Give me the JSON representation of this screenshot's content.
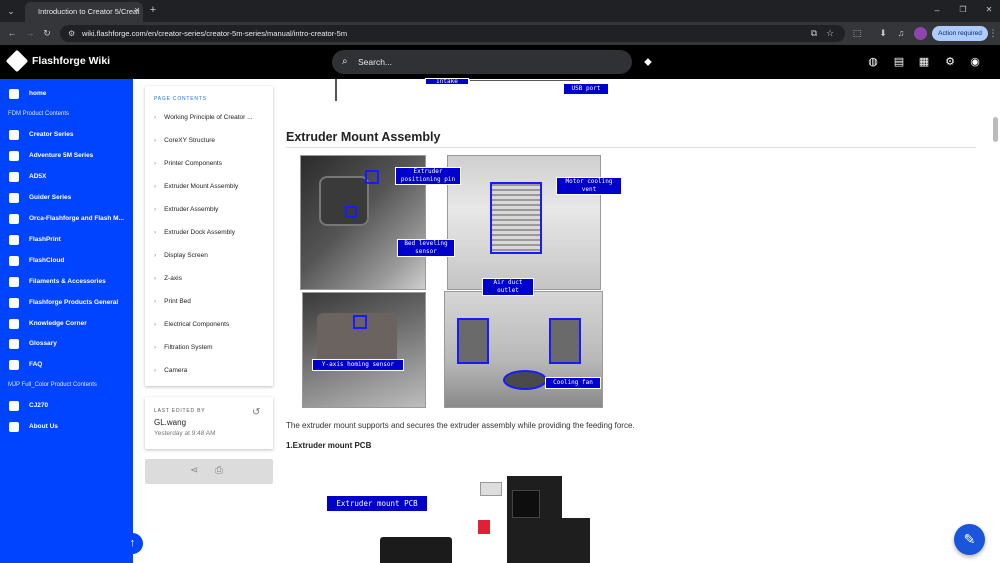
{
  "browser": {
    "tab_title": "Introduction to Creator 5/Creat",
    "url": "wiki.flashforge.com/en/creator-series/creator-5m-series/manual/intro-creator-5m",
    "action_label": "Action required"
  },
  "header": {
    "site_title": "Flashforge Wiki",
    "search_placeholder": "Search..."
  },
  "sidebar": {
    "items": [
      {
        "label": "home",
        "icon": "home-icon"
      },
      {
        "label": "FDM Product Contents",
        "section": true
      },
      {
        "label": "Creator Series",
        "icon": "creator-icon"
      },
      {
        "label": "Adventure 5M Series",
        "icon": "adventure-icon"
      },
      {
        "label": "AD5X",
        "icon": "ad5x-icon"
      },
      {
        "label": "Guider Series",
        "icon": "guider-icon"
      },
      {
        "label": "Orca-Flashforge and Flash M...",
        "icon": "orca-icon"
      },
      {
        "label": "FlashPrint",
        "icon": "flashprint-icon"
      },
      {
        "label": "FlashCloud",
        "icon": "cloud-icon"
      },
      {
        "label": "Filaments & Accessories",
        "icon": "filament-icon"
      },
      {
        "label": "Flashforge Products General",
        "icon": "gear-icon"
      },
      {
        "label": "Knowledge Corner",
        "icon": "knowledge-icon"
      },
      {
        "label": "Glossary",
        "icon": "sort-icon"
      },
      {
        "label": "FAQ",
        "icon": "help-icon"
      },
      {
        "label": "MJP Full_Color Product Contents",
        "section": true
      },
      {
        "label": "CJ270",
        "icon": "cj270-icon"
      },
      {
        "label": "About Us",
        "icon": "people-icon"
      }
    ]
  },
  "toc": {
    "title": "PAGE CONTENTS",
    "items": [
      "Working Principle of Creator ...",
      "CoreXY Structure",
      "Printer Components",
      "Extruder Mount Assembly",
      "Extruder Assembly",
      "Extruder Dock Assembly",
      "Display Screen",
      "Z-axis",
      "Print Bed",
      "Electrical Components",
      "Filtration System",
      "Camera"
    ]
  },
  "last_edited": {
    "label": "LAST EDITED BY",
    "user": "GL.wang",
    "time": "Yesterday at 9:48 AM"
  },
  "content": {
    "top_labels": [
      "Intake",
      "USB port"
    ],
    "heading": "Extruder Mount Assembly",
    "photo_labels": [
      "Extruder positioning pin",
      "Motor cooling vent",
      "Bed leveling sensor",
      "Air duct outlet",
      "Y-axis homing sensor",
      "Cooling fan"
    ],
    "paragraph": "The extruder mount supports and secures the extruder assembly while providing the feeding force.",
    "subheading": "1.Extruder mount PCB",
    "pcb_label": "Extruder mount PCB"
  }
}
